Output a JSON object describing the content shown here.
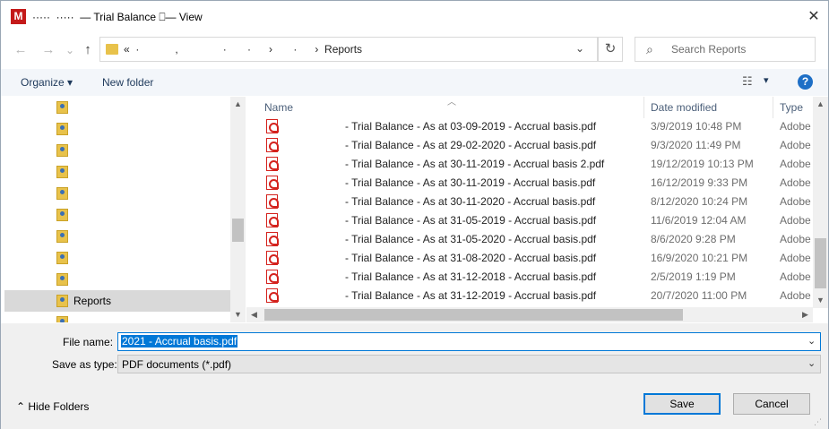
{
  "title_bar": {
    "app_icon": "M",
    "title": "·····  ·····  — Trial Balance ⎕— View",
    "close": "✕"
  },
  "nav": {
    "back": "←",
    "forward": "→",
    "down": "⌄",
    "up": "↑"
  },
  "address": {
    "text": "«  ·            ,               ·       ·      ›       ·      ›  Reports",
    "chevron": "⌄",
    "refresh": "↻"
  },
  "search": {
    "placeholder": "Search Reports",
    "icon": "⌕"
  },
  "toolbar": {
    "organize": "Organize ▾",
    "new_folder": "New folder",
    "view_icon": "☷",
    "view_chev": "▾",
    "help": "?"
  },
  "tree": [
    {
      "label": ""
    },
    {
      "label": ""
    },
    {
      "label": ""
    },
    {
      "label": ""
    },
    {
      "label": ""
    },
    {
      "label": ""
    },
    {
      "label": ""
    },
    {
      "label": ""
    },
    {
      "label": ""
    },
    {
      "label": "Reports"
    },
    {
      "label": ""
    }
  ],
  "columns": {
    "name": "Name",
    "date": "Date modified",
    "type": "Type"
  },
  "files": [
    {
      "name": "- Trial Balance - As at 03-09-2019 - Accrual basis.pdf",
      "date": "3/9/2019 10:48 PM",
      "type": "Adobe"
    },
    {
      "name": "- Trial Balance - As at 29-02-2020 - Accrual basis.pdf",
      "date": "9/3/2020 11:49 PM",
      "type": "Adobe"
    },
    {
      "name": "- Trial Balance - As at 30-11-2019 - Accrual basis 2.pdf",
      "date": "19/12/2019 10:13 PM",
      "type": "Adobe"
    },
    {
      "name": "- Trial Balance - As at 30-11-2019 - Accrual basis.pdf",
      "date": "16/12/2019 9:33 PM",
      "type": "Adobe"
    },
    {
      "name": "- Trial Balance - As at 30-11-2020 - Accrual basis.pdf",
      "date": "8/12/2020 10:24 PM",
      "type": "Adobe"
    },
    {
      "name": "- Trial Balance - As at 31-05-2019 - Accrual basis.pdf",
      "date": "11/6/2019 12:04 AM",
      "type": "Adobe"
    },
    {
      "name": "- Trial Balance - As at 31-05-2020 - Accrual basis.pdf",
      "date": "8/6/2020 9:28 PM",
      "type": "Adobe"
    },
    {
      "name": "- Trial Balance - As at 31-08-2020 - Accrual basis.pdf",
      "date": "16/9/2020 10:21 PM",
      "type": "Adobe"
    },
    {
      "name": "- Trial Balance - As at 31-12-2018 - Accrual basis.pdf",
      "date": "2/5/2019 1:19 PM",
      "type": "Adobe"
    },
    {
      "name": "- Trial Balance - As at 31-12-2019 - Accrual basis.pdf",
      "date": "20/7/2020 11:00 PM",
      "type": "Adobe"
    }
  ],
  "form": {
    "file_name_label": "File name:",
    "file_name_value": "2021 - Accrual basis.pdf",
    "save_as_label": "Save as type:",
    "save_as_value": "PDF documents (*.pdf)",
    "hide_folders": "⌃  Hide Folders",
    "save": "Save",
    "cancel": "Cancel"
  }
}
